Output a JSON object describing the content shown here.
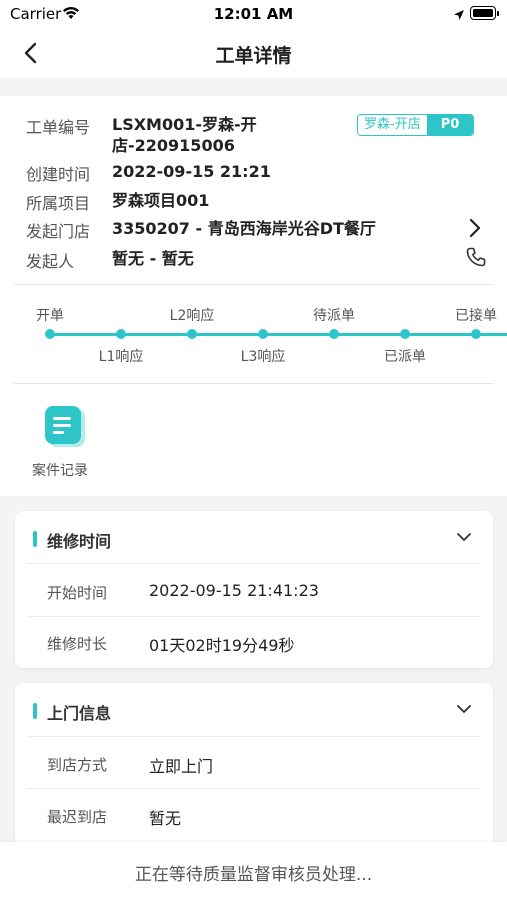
{
  "status_bar": {
    "carrier": "Carrier",
    "time": "12:01 AM"
  },
  "nav": {
    "title": "工单详情"
  },
  "info": {
    "order_no_label": "工单编号",
    "order_no_line1": "LSXM001-罗森-开",
    "order_no_line2": "店-220915006",
    "tag_text": "罗森-开店",
    "priority": "P0",
    "created_label": "创建时间",
    "created_value": "2022-09-15 21:21",
    "project_label": "所属项目",
    "project_value": "罗森项目001",
    "store_label": "发起门店",
    "store_value": "3350207 - 青岛西海岸光谷DT餐厅",
    "initiator_label": "发起人",
    "initiator_value": "暂无 - 暂无"
  },
  "timeline": [
    {
      "label": "开单"
    },
    {
      "label": "L1响应"
    },
    {
      "label": "L2响应"
    },
    {
      "label": "L3响应"
    },
    {
      "label": "待派单"
    },
    {
      "label": "已派单"
    },
    {
      "label": "已接单"
    }
  ],
  "case_record": {
    "label": "案件记录"
  },
  "repair_time": {
    "title": "维修时间",
    "rows": [
      {
        "label": "开始时间",
        "value": "2022-09-15 21:41:23"
      },
      {
        "label": "维修时长",
        "value": "01天02时19分49秒"
      }
    ]
  },
  "visit_info": {
    "title": "上门信息",
    "rows": [
      {
        "label": "到店方式",
        "value": "立即上门"
      },
      {
        "label": "最迟到店",
        "value": "暂无"
      }
    ]
  },
  "bottom": {
    "message": "正在等待质量监督审核员处理..."
  },
  "colors": {
    "accent": "#2ec5c8"
  }
}
